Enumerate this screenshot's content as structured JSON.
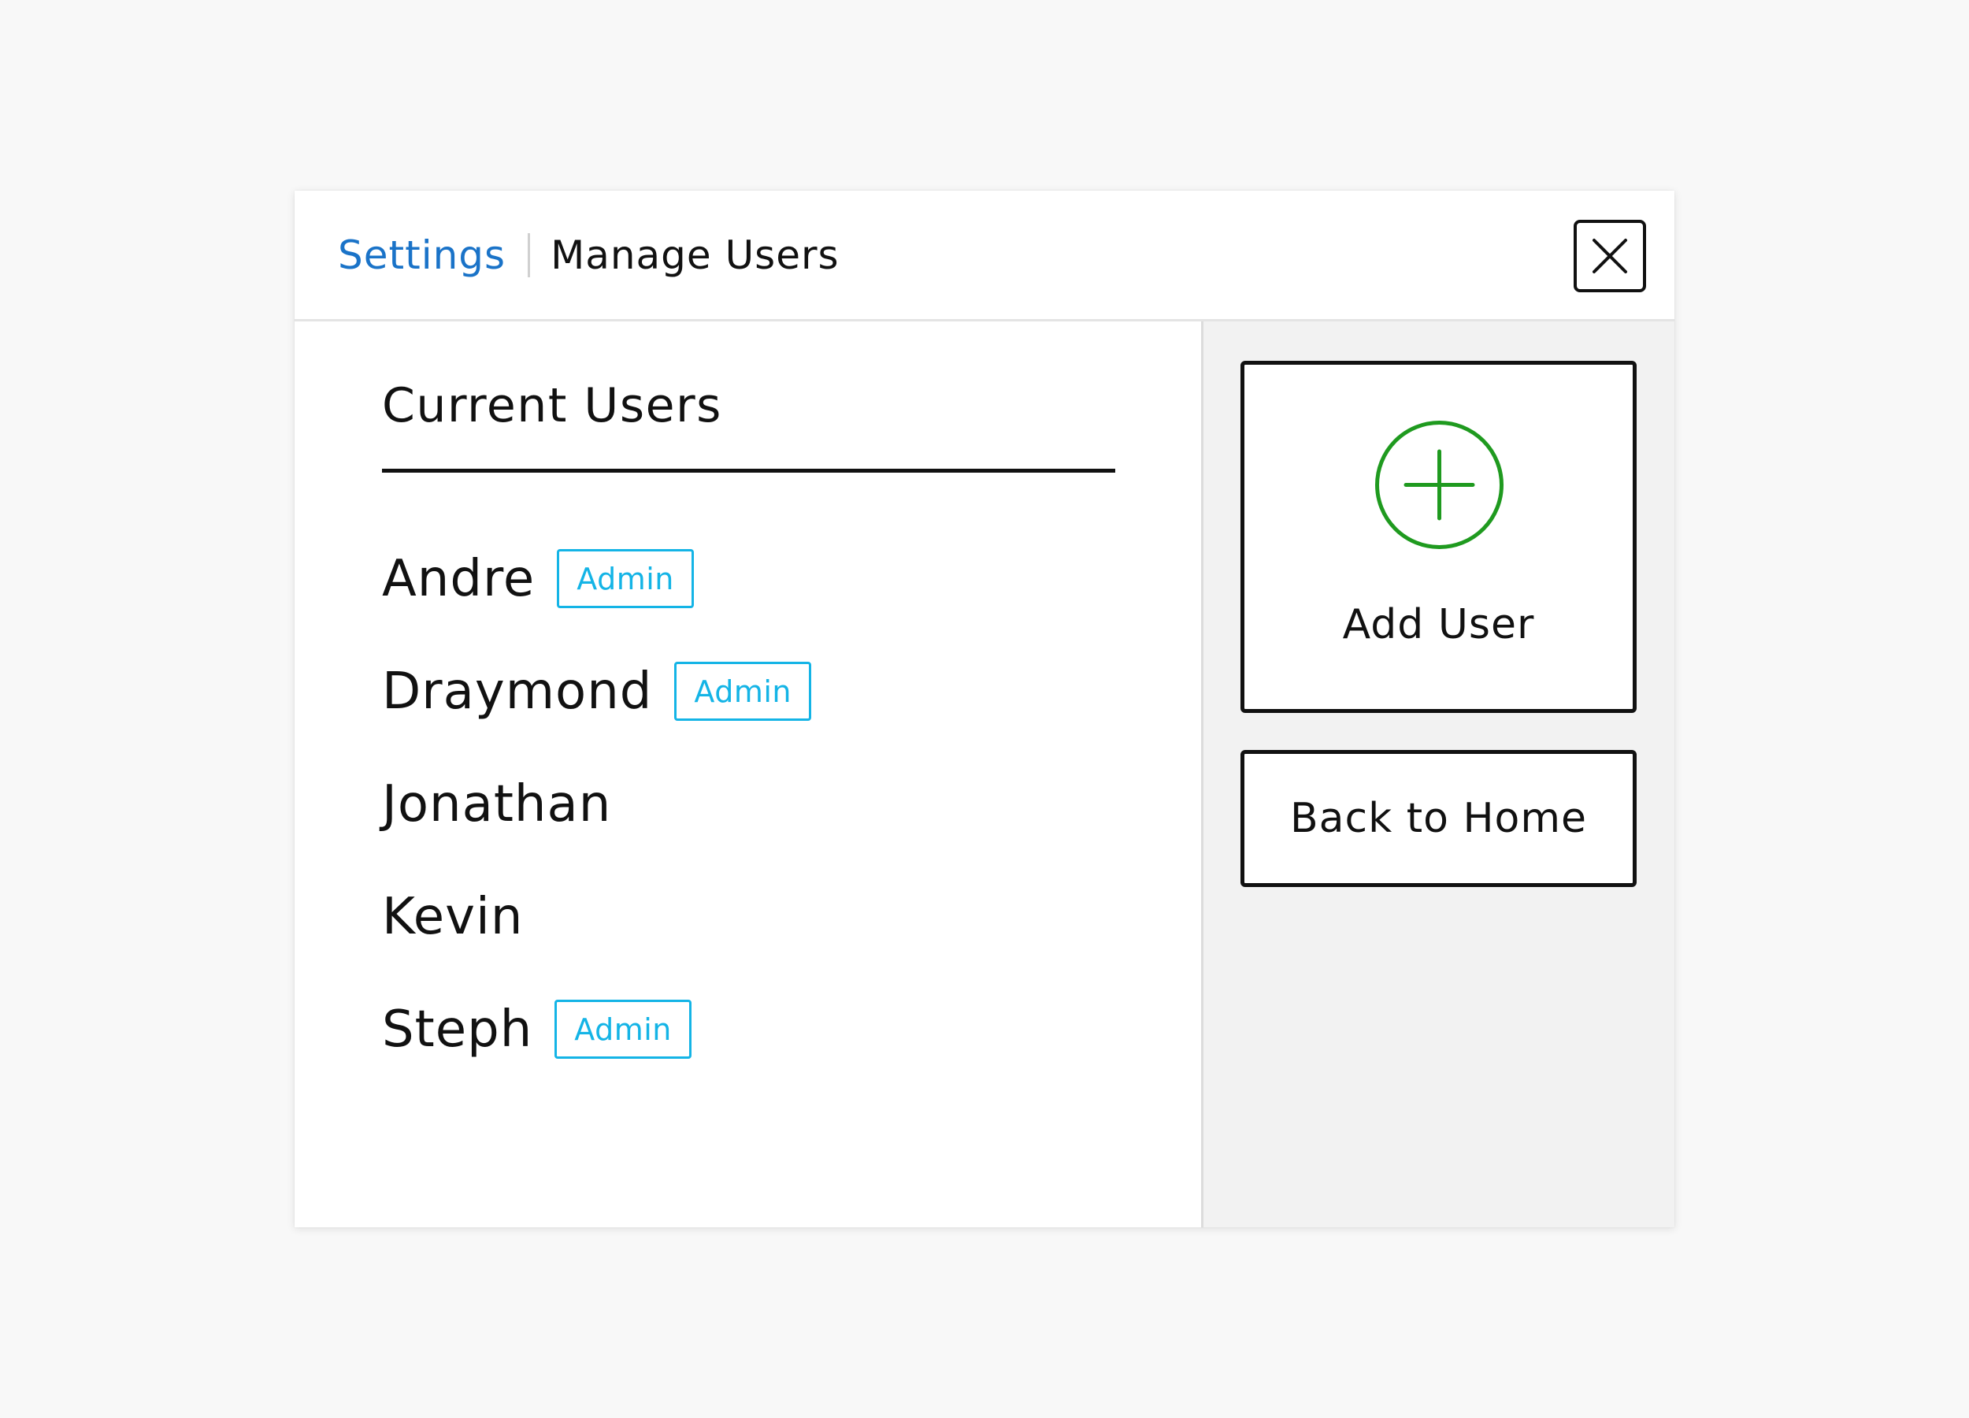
{
  "colors": {
    "link": "#1a73c8",
    "admin_badge": "#14b4e6",
    "add_icon": "#1f9a1f"
  },
  "header": {
    "breadcrumb_parent": "Settings",
    "breadcrumb_current": "Manage Users",
    "close_icon": "close-icon"
  },
  "users": {
    "title": "Current Users",
    "items": [
      {
        "name": "Andre",
        "badge": "Admin"
      },
      {
        "name": "Draymond",
        "badge": "Admin"
      },
      {
        "name": "Jonathan",
        "badge": ""
      },
      {
        "name": "Kevin",
        "badge": ""
      },
      {
        "name": "Steph",
        "badge": "Admin"
      }
    ]
  },
  "actions": {
    "add_user_label": "Add User",
    "add_user_icon": "plus-circle-icon",
    "back_home_label": "Back to Home"
  }
}
